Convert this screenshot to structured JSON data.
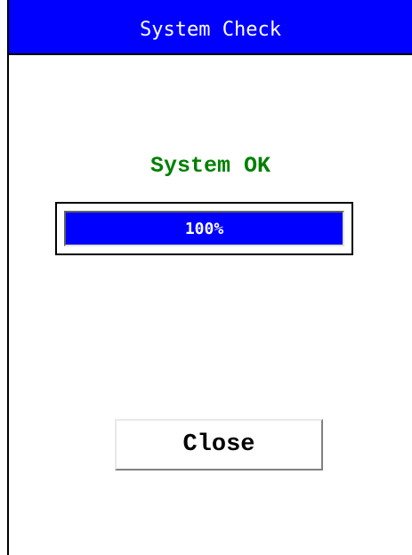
{
  "window": {
    "title": "System Check"
  },
  "status": {
    "text": "System OK",
    "color": "#008000"
  },
  "progress": {
    "value_percent": 100,
    "label": "100%",
    "fill_color": "#0000ff"
  },
  "buttons": {
    "close_label": "Close"
  },
  "colors": {
    "titlebar": "#0000ff",
    "title_text": "#ffffff"
  }
}
